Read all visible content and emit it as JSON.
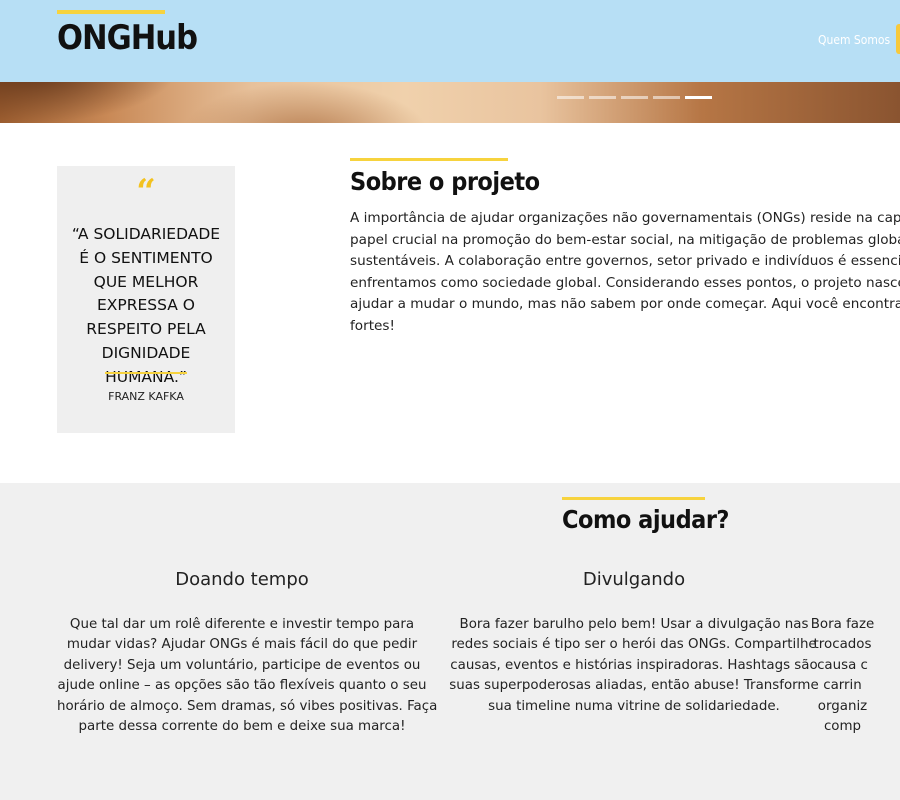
{
  "header": {
    "logo": "ONGHub",
    "nav_link": "Quem Somos"
  },
  "carousel": {
    "slides": 5,
    "active_slide": 5
  },
  "quote": {
    "mark": "“",
    "text": "“A SOLIDARIEDADE É O SENTIMENTO QUE MELHOR EXPRESSA O RESPEITO PELA DIGNIDADE HUMANA.”",
    "author": "FRANZ KAFKA"
  },
  "about": {
    "title": "Sobre o projeto",
    "text": "A importância de ajudar organizações não governamentais (ONGs) reside na capacida\npapel crucial na promoção do bem-estar social, na mitigação de problemas globais e\nsustentáveis. A colaboração entre governos, setor privado e indivíduos é essencial pa\nenfrentamos como sociedade global. Considerando esses pontos, o projeto nasceu co\najudar a mudar o mundo, mas não sabem por onde começar. Aqui você encontra dive\nfortes!"
  },
  "help": {
    "title": "Como ajudar?",
    "columns": [
      {
        "title": "Doando tempo",
        "text": "Que tal dar um rolê diferente e investir tempo para\nmudar vidas? Ajudar ONGs é mais fácil do que pedir\ndelivery! Seja um voluntário, participe de eventos ou\najude online – as opções são tão flexíveis quanto o seu\nhorário de almoço. Sem dramas, só vibes positivas. Faça\nparte dessa corrente do bem e deixe sua marca!"
      },
      {
        "title": "Divulgando",
        "text": "Bora fazer barulho pelo bem! Usar a divulgação nas\nredes sociais é tipo ser o herói das ONGs. Compartilhe\ncausas, eventos e histórias inspiradoras. Hashtags são\nsuas superpoderosas aliadas, então abuse! Transforme\nsua timeline numa vitrine de solidariedade."
      },
      {
        "title": "",
        "text": "Bora faze\ntrocados\ncausa c\ncarrin\norganiz\ncomp"
      }
    ]
  },
  "colors": {
    "header_bg": "#b7dff5",
    "accent_yellow": "#f7d33e",
    "section_bg": "#f0f0f0"
  }
}
